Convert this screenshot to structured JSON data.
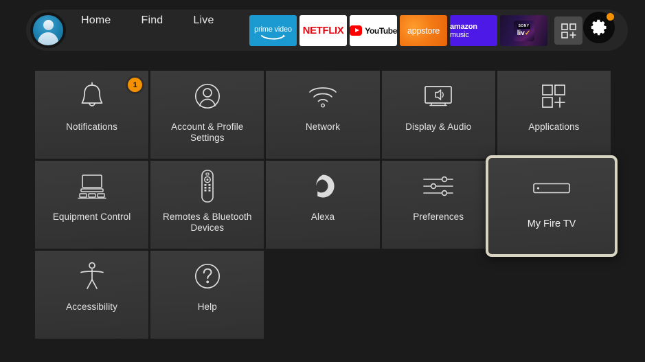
{
  "nav": {
    "avatar_name": "profile-avatar",
    "links": [
      {
        "label": "Home"
      },
      {
        "label": "Find"
      },
      {
        "label": "Live"
      }
    ],
    "apps": [
      {
        "name": "prime-video",
        "text": "prime video"
      },
      {
        "name": "netflix",
        "text": "NETFLIX"
      },
      {
        "name": "youtube",
        "text": "YouTube"
      },
      {
        "name": "appstore",
        "text": "appstore"
      },
      {
        "name": "amazon-music",
        "text_light": "amazon",
        "text_bold": " music"
      },
      {
        "name": "sony-liv",
        "text_top": "SONY",
        "text_main": "liv"
      }
    ],
    "apps_grid_label": "apps-grid-button",
    "settings_label": "settings-gear-button",
    "settings_badge_visible": true
  },
  "colors": {
    "accent_orange": "#f59100",
    "selection_border": "#d9d3c2",
    "tile_bg": "#373737",
    "page_bg": "#1b1b1b",
    "text_primary": "#e2e2e2",
    "prime_blue": "#1a9ad1",
    "netflix_red": "#e50914",
    "youtube_red": "#ff0000",
    "amazon_music_purple": "#4d19e6"
  },
  "settings_grid": {
    "rows": [
      [
        {
          "id": "notifications",
          "label": "Notifications",
          "icon": "bell-icon",
          "badge": "1"
        },
        {
          "id": "account-profile-settings",
          "label": "Account & Profile Settings",
          "icon": "person-circle-icon"
        },
        {
          "id": "network",
          "label": "Network",
          "icon": "wifi-icon"
        },
        {
          "id": "display-audio",
          "label": "Display & Audio",
          "icon": "tv-speaker-icon"
        },
        {
          "id": "applications",
          "label": "Applications",
          "icon": "app-grid-plus-icon"
        }
      ],
      [
        {
          "id": "equipment-control",
          "label": "Equipment Control",
          "icon": "tv-devices-icon"
        },
        {
          "id": "remotes-bluetooth-devices",
          "label": "Remotes & Bluetooth Devices",
          "icon": "remote-control-icon"
        },
        {
          "id": "alexa",
          "label": "Alexa",
          "icon": "alexa-ring-icon"
        },
        {
          "id": "preferences",
          "label": "Preferences",
          "icon": "sliders-icon"
        }
      ],
      [
        {
          "id": "accessibility",
          "label": "Accessibility",
          "icon": "accessibility-person-icon"
        },
        {
          "id": "help",
          "label": "Help",
          "icon": "question-circle-icon"
        }
      ]
    ],
    "selected": {
      "id": "my-fire-tv",
      "label": "My Fire TV",
      "icon": "fire-tv-stick-icon"
    }
  }
}
